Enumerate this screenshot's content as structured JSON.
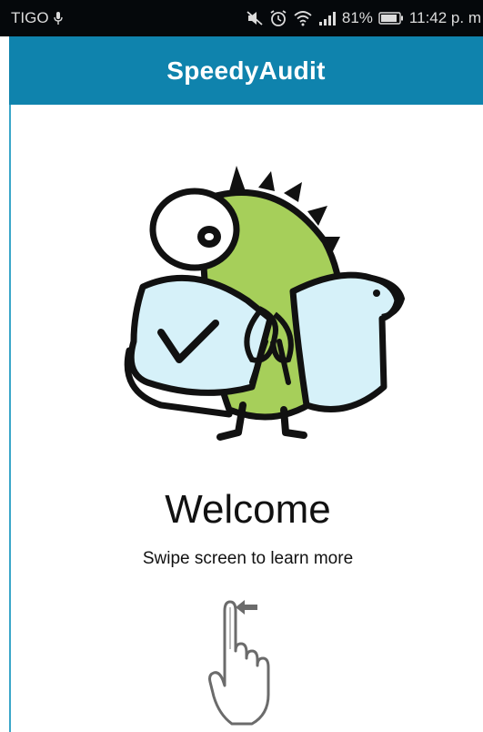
{
  "status_bar": {
    "carrier": "TIGO",
    "battery": "81%",
    "time": "11:42 p. m"
  },
  "app_bar": {
    "title": "SpeedyAudit"
  },
  "onboarding": {
    "title": "Welcome",
    "subtitle": "Swipe screen to learn more",
    "illustration": "fish-mascot-illustration",
    "gesture_icon": "swipe-left-hand-icon"
  },
  "colors": {
    "app_bar": "#0f83ad",
    "status_bar": "#05080b",
    "mascot_body": "#a6cf5a",
    "mascot_coat": "#d6f1f9"
  }
}
